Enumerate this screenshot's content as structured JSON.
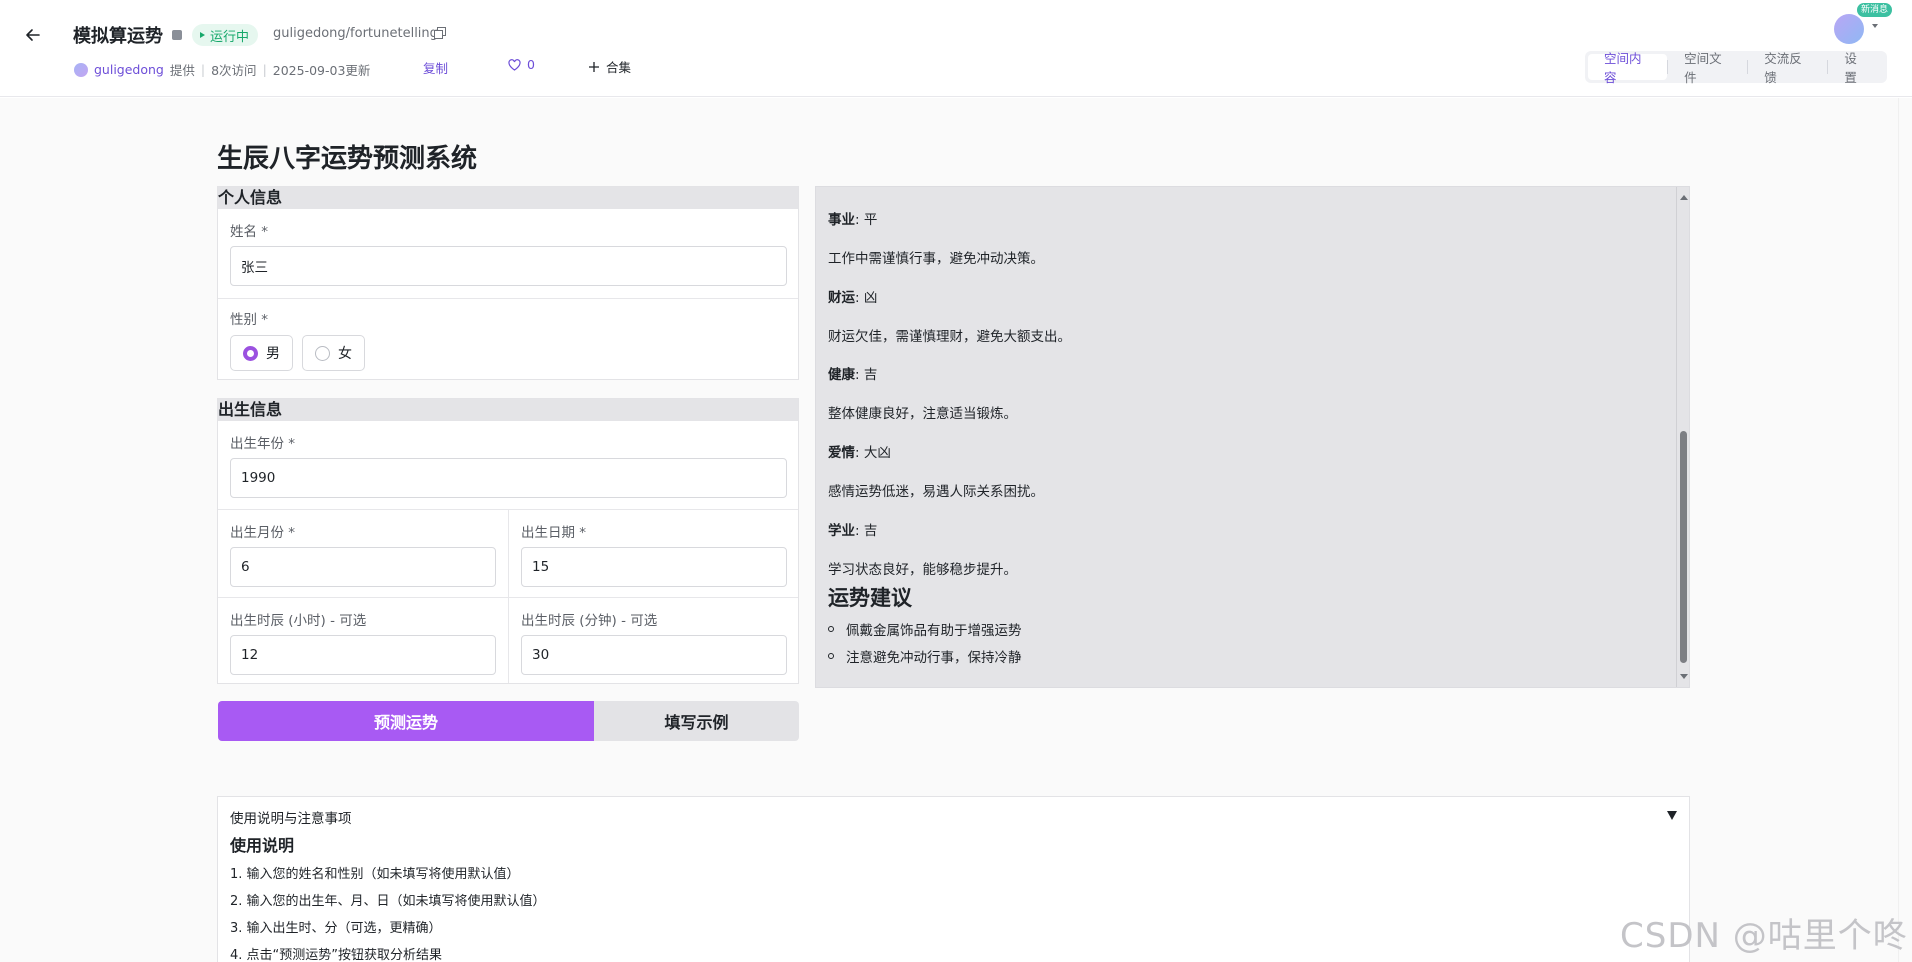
{
  "header": {
    "title": "模拟算运势",
    "status": "运行中",
    "repo_path": "guligedong/fortunetelling",
    "author": "guligedong",
    "provided": "提供",
    "visits": "8次访问",
    "updated": "2025-09-03更新",
    "copy_label": "复制",
    "likes": "0",
    "collection_label": "合集",
    "new_badge": "新消息",
    "tabs": [
      "空间内容",
      "空间文件",
      "交流反馈",
      "设置"
    ]
  },
  "app": {
    "title": "生辰八字运势预测系统",
    "personal": {
      "heading": "个人信息",
      "name_label": "姓名 *",
      "name_value": "张三",
      "gender_label": "性别 *",
      "male": "男",
      "female": "女"
    },
    "birth": {
      "heading": "出生信息",
      "year_label": "出生年份 *",
      "year_value": "1990",
      "month_label": "出生月份 *",
      "month_value": "6",
      "day_label": "出生日期 *",
      "day_value": "15",
      "hour_label": "出生时辰 (小时) - 可选",
      "hour_value": "12",
      "minute_label": "出生时辰 (分钟) - 可选",
      "minute_value": "30"
    },
    "buttons": {
      "predict": "预测运势",
      "example": "填写示例"
    }
  },
  "result": {
    "items": [
      {
        "key": "事业",
        "value": ": 平",
        "desc": "工作中需谨慎行事，避免冲动决策。"
      },
      {
        "key": "财运",
        "value": ": 凶",
        "desc": "财运欠佳，需谨慎理财，避免大额支出。"
      },
      {
        "key": "健康",
        "value": ": 吉",
        "desc": "整体健康良好，注意适当锻炼。"
      },
      {
        "key": "爱情",
        "value": ": 大凶",
        "desc": "感情运势低迷，易遇人际关系困扰。"
      },
      {
        "key": "学业",
        "value": ": 吉",
        "desc": "学习状态良好，能够稳步提升。"
      }
    ],
    "advice_title": "运势建议",
    "advice": [
      "佩戴金属饰品有助于增强运势",
      "注意避免冲动行事，保持冷静"
    ]
  },
  "instructions": {
    "accordion_label": "使用说明与注意事项",
    "title": "使用说明",
    "lines": [
      "1. 输入您的姓名和性别（如未填写将使用默认值）",
      "2. 输入您的出生年、月、日（如未填写将使用默认值）",
      "3. 输入出生时、分（可选，更精确）",
      "4. 点击“预测运势”按钮获取分析结果"
    ]
  },
  "watermark": "CSDN @咕里个咚"
}
